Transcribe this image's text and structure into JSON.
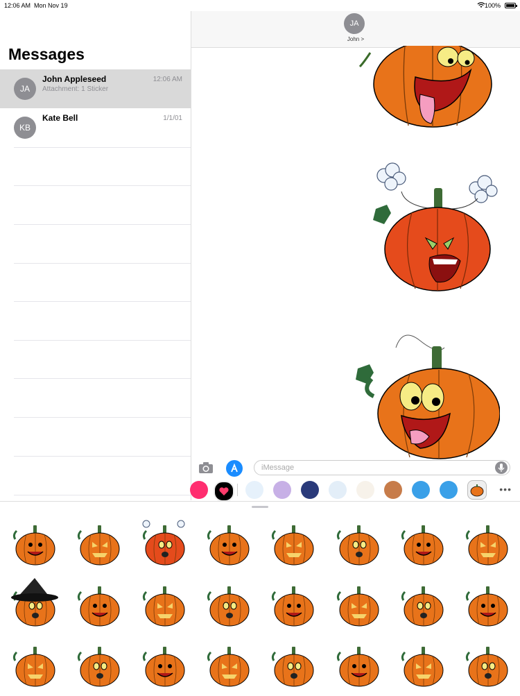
{
  "status": {
    "time": "12:06 AM",
    "date": "Mon Nov 19",
    "battery": "100%"
  },
  "sidebar": {
    "title": "Messages",
    "conversations": [
      {
        "initials": "JA",
        "name": "John Appleseed",
        "preview": "Attachment: 1 Sticker",
        "time": "12:06 AM",
        "selected": true
      },
      {
        "initials": "KB",
        "name": "Kate Bell",
        "preview": "",
        "time": "1/1/01",
        "selected": false
      }
    ]
  },
  "conversation": {
    "initials": "JA",
    "name": "John >",
    "input_placeholder": "iMessage"
  },
  "colors": {
    "pumpkin": "#e8731a",
    "selected_row": "#d9d9d9",
    "avatar": "#8e8e93",
    "accent": "#1a8cff"
  },
  "icons": {
    "camera": "camera-icon",
    "appstore": "app-store-icon",
    "mic": "microphone-icon",
    "more": "more-icon"
  }
}
